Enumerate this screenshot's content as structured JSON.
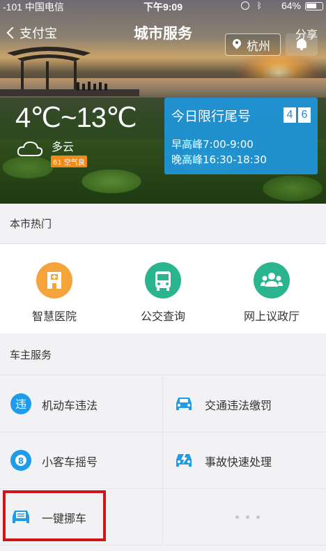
{
  "status_bar": {
    "carrier": "-101 中国电信",
    "time": "下午9:09",
    "battery": "64%"
  },
  "nav": {
    "back_label": "支付宝",
    "title": "城市服务",
    "share_label": "分享",
    "city": "杭州"
  },
  "weather": {
    "temperature": "4℃~13℃",
    "condition": "多云",
    "aqi": "61 空气良"
  },
  "traffic_limit": {
    "title": "今日限行尾号",
    "digits": [
      "4",
      "6"
    ],
    "morning_peak": "早高峰7:00-9:00",
    "evening_peak": "晚高峰16:30-18:30"
  },
  "hot_section": {
    "title": "本市热门",
    "items": [
      {
        "label": "智慧医院",
        "icon": "hospital-icon",
        "color": "#f5a33b"
      },
      {
        "label": "公交查询",
        "icon": "bus-icon",
        "color": "#2bb58e"
      },
      {
        "label": "网上议政厅",
        "icon": "people-icon",
        "color": "#2bb58e"
      }
    ]
  },
  "car_section": {
    "title": "车主服务",
    "items": [
      {
        "label": "机动车违法",
        "icon": "violation-icon"
      },
      {
        "label": "交通违法缴罚",
        "icon": "car-icon"
      },
      {
        "label": "小客车摇号",
        "icon": "lottery-icon"
      },
      {
        "label": "事故快速处理",
        "icon": "accident-car-icon"
      },
      {
        "label": "一键挪车",
        "icon": "move-car-icon"
      },
      {
        "label": "",
        "icon": "more-dots-icon"
      }
    ],
    "accent_color": "#1e9be9"
  }
}
